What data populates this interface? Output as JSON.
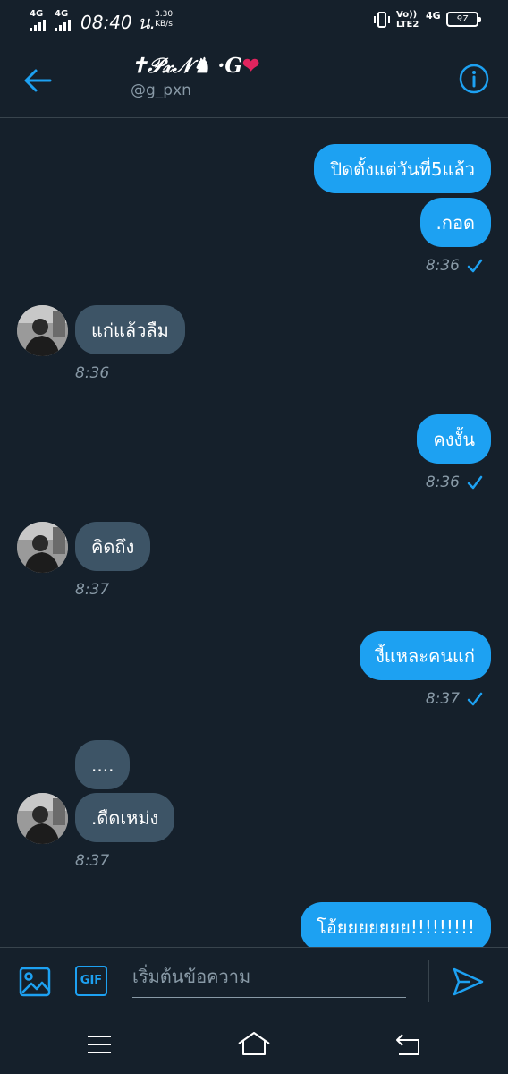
{
  "status_bar": {
    "network1": "4G",
    "network2": "4G",
    "time": "08:40 น.",
    "speed_value": "3.30",
    "speed_unit": "KB/s",
    "volte_top": "Vo))",
    "volte_bottom": "LTE2",
    "network3": "4G",
    "battery": "97"
  },
  "header": {
    "title": "✝𝒫𝓍𝒩♞ ·G",
    "title_emoji": "❤",
    "handle": "@g_pxn"
  },
  "messages": [
    {
      "text": "ปิดตั้งแต่วันที่5แล้ว",
      "direction": "outgoing"
    },
    {
      "text": ".กอด",
      "direction": "outgoing",
      "time": "8:36"
    },
    {
      "text": "แก่แล้วลืม",
      "direction": "incoming",
      "time": "8:36"
    },
    {
      "text": "คงงั้น",
      "direction": "outgoing",
      "time": "8:36"
    },
    {
      "text": "คิดถึง",
      "direction": "incoming",
      "time": "8:37"
    },
    {
      "text": "งี้แหละคนแก่",
      "direction": "outgoing",
      "time": "8:37"
    },
    {
      "text": "....",
      "direction": "incoming"
    },
    {
      "text": ".ดืดเหม่ง",
      "direction": "incoming",
      "time": "8:37"
    },
    {
      "text": "โอ้ยยยยยยย!!!!!!!!!",
      "direction": "outgoing"
    }
  ],
  "composer": {
    "gif_label": "GIF",
    "placeholder": "เริ่มต้นข้อความ"
  },
  "colors": {
    "background": "#15202b",
    "accent": "#1da1f2",
    "incoming_bubble": "#3d5466",
    "muted_text": "#8899a6"
  }
}
